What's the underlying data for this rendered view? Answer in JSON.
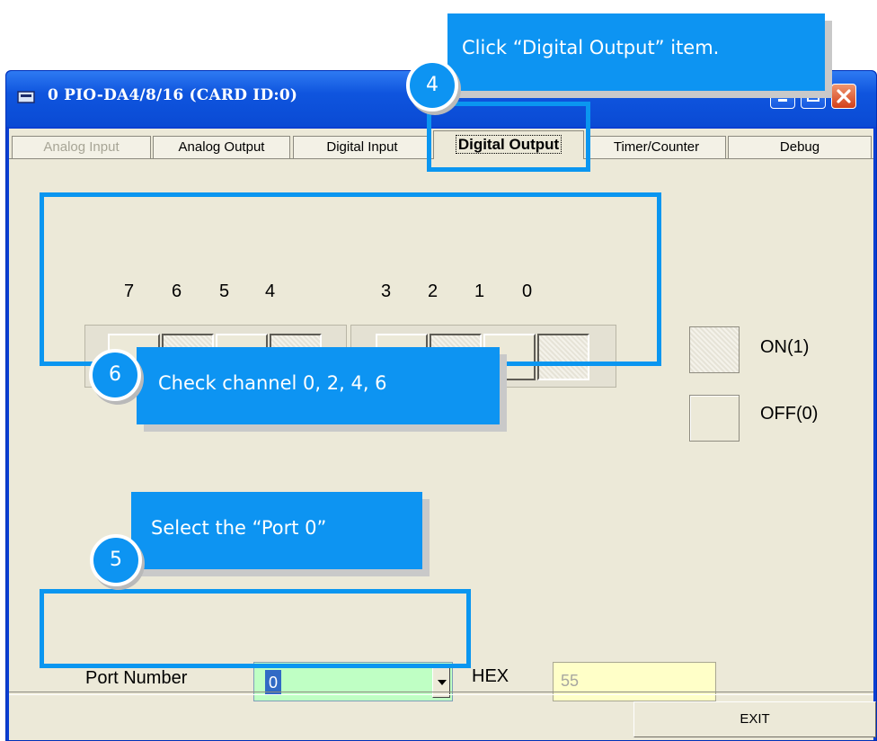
{
  "window": {
    "title": "0 PIO-DA4/8/16 (CARD ID:0)"
  },
  "tabs": [
    {
      "label": "Analog Input",
      "state": "disabled"
    },
    {
      "label": "Analog Output",
      "state": "normal"
    },
    {
      "label": "Digital Input",
      "state": "normal"
    },
    {
      "label": "Digital Output",
      "state": "selected"
    },
    {
      "label": "Timer/Counter",
      "state": "normal"
    },
    {
      "label": "Debug",
      "state": "normal"
    }
  ],
  "digital_output": {
    "channel_labels": [
      "7",
      "6",
      "5",
      "4",
      "3",
      "2",
      "1",
      "0"
    ],
    "channel_states": [
      "off",
      "on",
      "off",
      "on",
      "off",
      "on",
      "off",
      "on"
    ]
  },
  "legend": {
    "on_label": "ON(1)",
    "off_label": "OFF(0)"
  },
  "port": {
    "label": "Port Number",
    "value": "0"
  },
  "hex": {
    "label": "HEX",
    "value": "55"
  },
  "exit_label": "EXIT",
  "annotations": {
    "step4": {
      "badge": "4",
      "text": "Click “Digital Output” item."
    },
    "step5": {
      "badge": "5",
      "text": "Select the “Port 0”"
    },
    "step6": {
      "badge": "6",
      "text": "Check channel 0, 2, 4, 6"
    }
  },
  "colors": {
    "accent": "#0d94f2",
    "title_bar": "#0a4ad4",
    "port_combo_bg": "#bfffc4",
    "hex_field_bg": "#ffffc8"
  },
  "icons": [
    "app-icon",
    "minimize-icon",
    "maximize-icon",
    "close-icon",
    "dropdown-arrow-icon"
  ]
}
